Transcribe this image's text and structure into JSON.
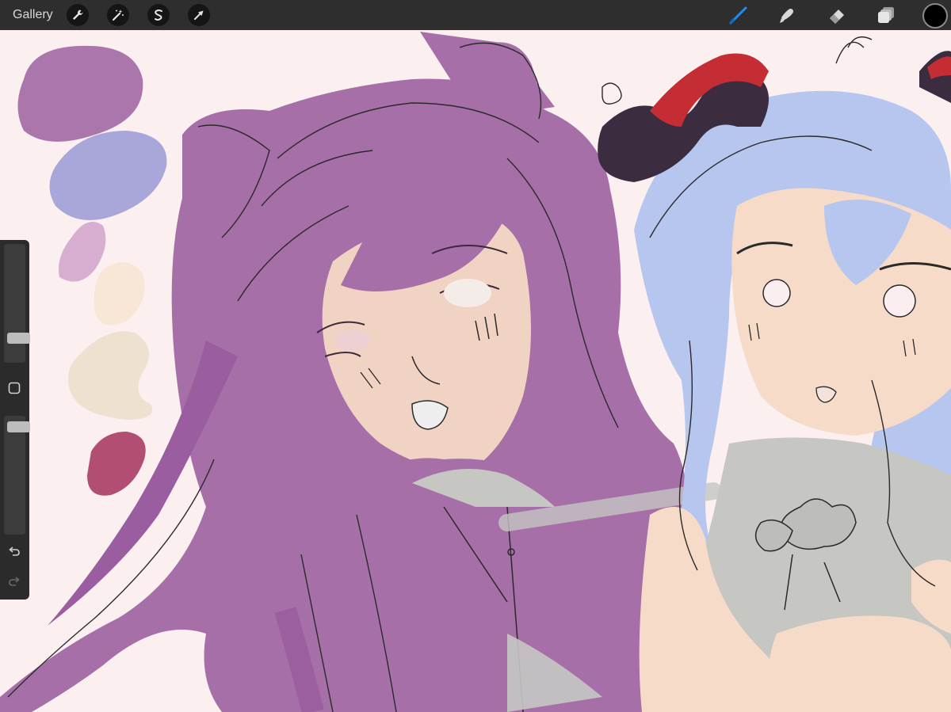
{
  "toolbar": {
    "gallery_label": "Gallery",
    "left_tools": [
      "wrench-icon",
      "magic-wand-icon",
      "selection-icon",
      "transform-icon"
    ],
    "right_tools": [
      "brush-icon",
      "smudge-icon",
      "eraser-icon",
      "layers-icon"
    ],
    "active_tool": "brush-icon",
    "active_color": "#000000",
    "accent_color": "#1e8cf0"
  },
  "sidebar": {
    "brush_size_level": 0.18,
    "opacity_level": 0.95,
    "buttons": [
      "modify-button",
      "undo-icon",
      "redo-icon"
    ]
  },
  "palette_colors": {
    "purple_hair": "#a66fa8",
    "blue_hair": "#b7c6ef",
    "skin": "#f6dcc8",
    "shirt_grey": "#c6c6c3",
    "horn_dark": "#3b2c3f",
    "horn_red": "#c42d33",
    "rose": "#b24d73"
  }
}
